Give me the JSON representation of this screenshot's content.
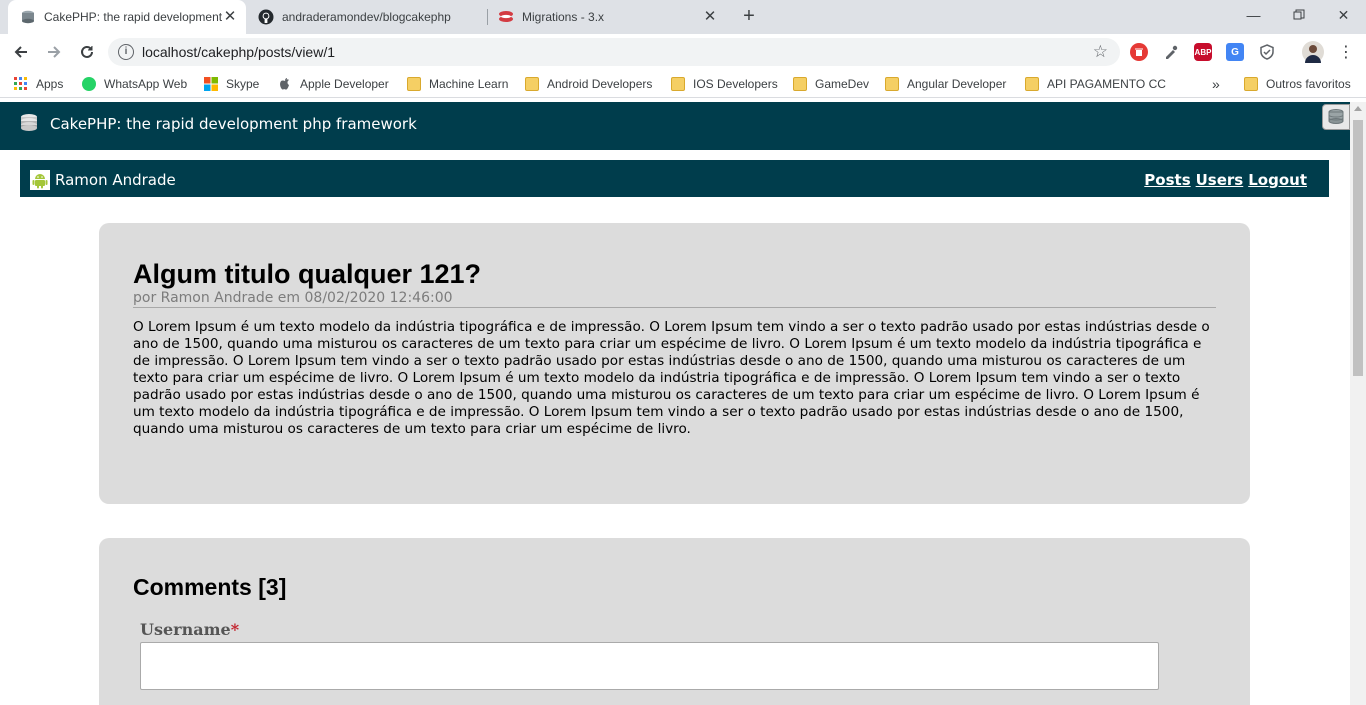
{
  "browser": {
    "tabs": [
      {
        "title": "CakePHP: the rapid development",
        "active": true,
        "icon": "cakephp-icon"
      },
      {
        "title": "andraderamondev/blogcakephp",
        "active": false,
        "icon": "github-icon"
      },
      {
        "title": "Migrations - 3.x",
        "active": false,
        "icon": "cakephp-red-icon"
      }
    ],
    "address": "localhost/cakephp/posts/view/1",
    "bookmarks": [
      {
        "label": "Apps",
        "icon": "apps-grid-icon"
      },
      {
        "label": "WhatsApp Web",
        "icon": "whatsapp-icon"
      },
      {
        "label": "Skype",
        "icon": "windows-icon"
      },
      {
        "label": "Apple Developer",
        "icon": "apple-icon"
      },
      {
        "label": "Machine Learn",
        "icon": "folder-icon"
      },
      {
        "label": "Android Developers",
        "icon": "folder-icon"
      },
      {
        "label": "IOS Developers",
        "icon": "folder-icon"
      },
      {
        "label": "GameDev",
        "icon": "folder-icon"
      },
      {
        "label": "Angular Developer",
        "icon": "folder-icon"
      },
      {
        "label": "API PAGAMENTO CC",
        "icon": "folder-icon"
      }
    ],
    "bookmarks_overflow": "»",
    "other_bookmarks": "Outros favoritos",
    "extensions": [
      {
        "name": "trash-extension",
        "color": "#e53935",
        "glyph": "🗑"
      },
      {
        "name": "eyedropper-extension",
        "color": "#5f6368",
        "glyph": ""
      },
      {
        "name": "adblock-plus-extension",
        "color": "#c70d2c",
        "glyph": "ABP"
      },
      {
        "name": "google-translate-extension",
        "color": "#4285f4",
        "glyph": "G"
      },
      {
        "name": "shield-extension",
        "color": "#5f6368",
        "glyph": ""
      }
    ]
  },
  "site": {
    "header_title": "CakePHP: the rapid development php framework",
    "user_name": "Ramon Andrade",
    "nav": {
      "posts": "Posts",
      "users": "Users",
      "logout": "Logout"
    }
  },
  "post": {
    "title": "Algum titulo qualquer 121?",
    "meta": "por Ramon Andrade em 08/02/2020 12:46:00",
    "body": "O Lorem Ipsum é um texto modelo da indústria tipográfica e de impressão. O Lorem Ipsum tem vindo a ser o texto padrão usado por estas indústrias desde o ano de 1500, quando uma misturou os caracteres de um texto para criar um espécime de livro. O Lorem Ipsum é um texto modelo da indústria tipográfica e de impressão. O Lorem Ipsum tem vindo a ser o texto padrão usado por estas indústrias desde o ano de 1500, quando uma misturou os caracteres de um texto para criar um espécime de livro. O Lorem Ipsum é um texto modelo da indústria tipográfica e de impressão. O Lorem Ipsum tem vindo a ser o texto padrão usado por estas indústrias desde o ano de 1500, quando uma misturou os caracteres de um texto para criar um espécime de livro. O Lorem Ipsum é um texto modelo da indústria tipográfica e de impressão. O Lorem Ipsum tem vindo a ser o texto padrão usado por estas indústrias desde o ano de 1500, quando uma misturou os caracteres de um texto para criar um espécime de livro."
  },
  "comments": {
    "title": "Comments [3]",
    "username_label": "Username",
    "required_mark": "*",
    "username_value": ""
  },
  "colors": {
    "header_bg": "#003d4c",
    "card_bg": "#dcdcdc",
    "required": "#c3232d"
  }
}
